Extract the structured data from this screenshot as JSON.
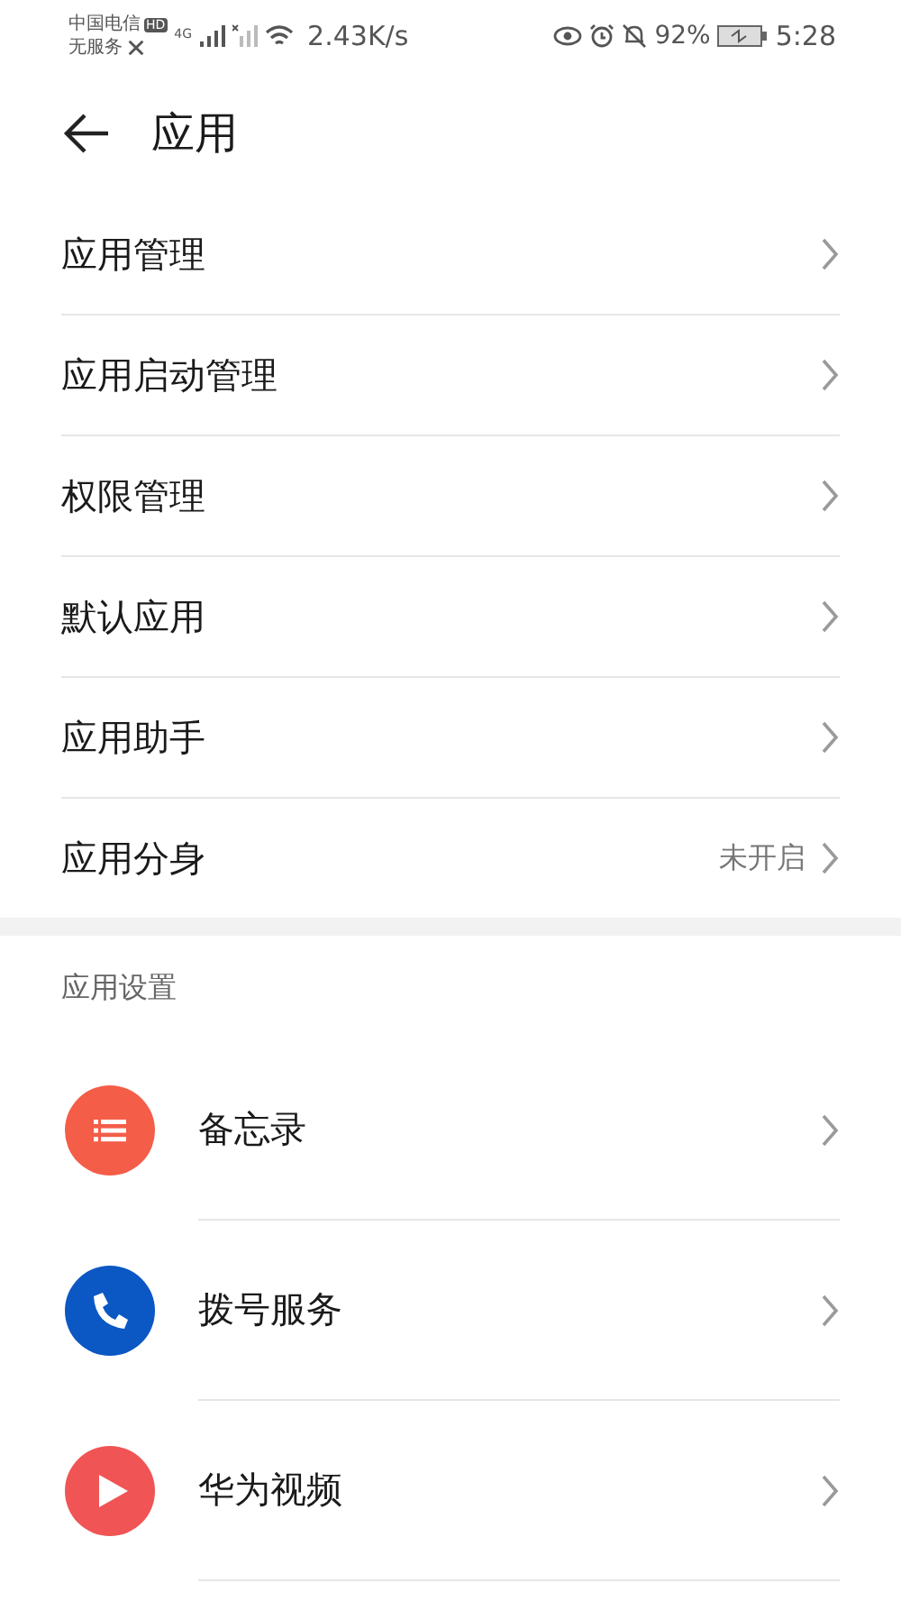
{
  "status_bar": {
    "carrier": "中国电信",
    "hd": "HD",
    "service": "无服务",
    "network": "4G",
    "speed": "2.43K/s",
    "battery": "92%",
    "time": "5:28"
  },
  "header": {
    "title": "应用"
  },
  "menu": [
    {
      "label": "应用管理"
    },
    {
      "label": "应用启动管理"
    },
    {
      "label": "权限管理"
    },
    {
      "label": "默认应用"
    },
    {
      "label": "应用助手"
    },
    {
      "label": "应用分身",
      "value": "未开启"
    }
  ],
  "section": {
    "title": "应用设置"
  },
  "apps": [
    {
      "name": "备忘录",
      "kind": "list",
      "color": "#f45d48"
    },
    {
      "name": "拨号服务",
      "kind": "phone",
      "color": "#0b57c4"
    },
    {
      "name": "华为视频",
      "kind": "play",
      "color": "#f05454"
    }
  ]
}
